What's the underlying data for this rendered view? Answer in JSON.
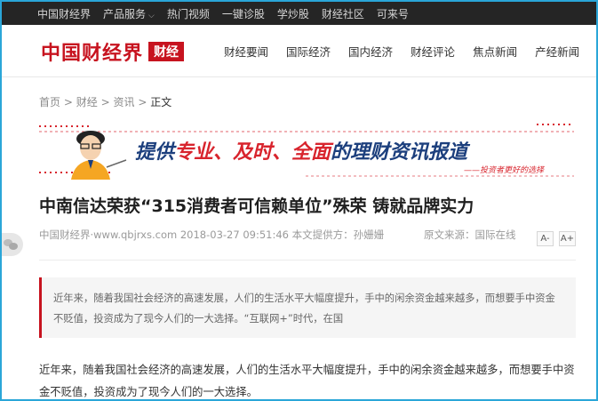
{
  "topbar": {
    "items": [
      "中国财经界",
      "产品服务",
      "热门视频",
      "一键诊股",
      "学炒股",
      "财经社区",
      "可来号"
    ]
  },
  "logo": {
    "main": "中国财经界",
    "tag": "财经"
  },
  "nav": {
    "items": [
      "财经要闻",
      "国际经济",
      "国内经济",
      "财经评论",
      "焦点新闻",
      "产经新闻"
    ]
  },
  "breadcrumb": {
    "items": [
      "首页",
      "财经",
      "资讯"
    ],
    "separator": ">",
    "current": "正文"
  },
  "banner": {
    "slogan_p1": "提供",
    "slogan_p2": "专业、及时、全面",
    "slogan_p3": "的理财资讯报道",
    "tagline": "——投资者更好的选择"
  },
  "article": {
    "title": "中南信达荣获“315消费者可信赖单位”殊荣 铸就品牌实力",
    "meta": "中国财经界·www.qbjrxs.com 2018-03-27 09:51:46  本文提供方：孙姗姗",
    "source": "原文来源：国际在线",
    "font_small": "A-",
    "font_large": "A+",
    "summary": "近年来，随着我国社会经济的高速发展，人们的生活水平大幅度提升，手中的闲余资金越来越多，而想要手中资金不贬值，投资成为了现今人们的一大选择。“互联网+”时代，在国",
    "paragraph1": "近年来，随着我国社会经济的高速发展，人们的生活水平大幅度提升，手中的闲余资金越来越多，而想要手中资金不贬值，投资成为了现今人们的一大选择。"
  },
  "colors": {
    "brand_red": "#c7131f",
    "topbar_bg": "#252525",
    "banner_blue": "#1c3f7d",
    "banner_red": "#d8242d",
    "frame": "#2aa6d8"
  },
  "icons": {
    "wechat": "wechat-icon",
    "dropdown": "chevron-down-icon"
  }
}
